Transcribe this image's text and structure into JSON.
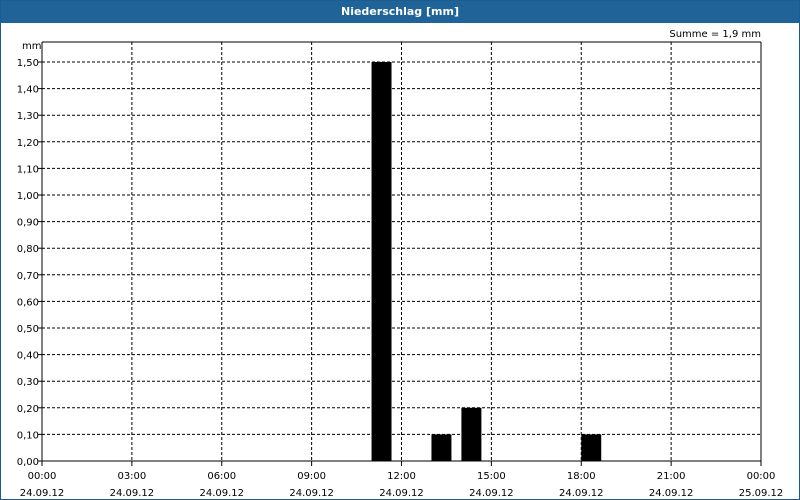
{
  "window": {
    "title": "Niederschlag [mm]"
  },
  "colors": {
    "titlebar": "#1f6399",
    "bars": "#000000"
  },
  "chart_data": {
    "type": "bar",
    "title": "Niederschlag [mm]",
    "ylabel": "mm",
    "summary": "Summe = 1,9 mm",
    "ylim": [
      0,
      1.5
    ],
    "yticks": [
      "0,00",
      "0,10",
      "0,20",
      "0,30",
      "0,40",
      "0,50",
      "0,60",
      "0,70",
      "0,80",
      "0,90",
      "1,00",
      "1,10",
      "1,20",
      "1,30",
      "1,40",
      "1,50"
    ],
    "xlim_hours": [
      0,
      24
    ],
    "xticks": [
      {
        "time": "00:00",
        "date": "24.09.12"
      },
      {
        "time": "03:00",
        "date": "24.09.12"
      },
      {
        "time": "06:00",
        "date": "24.09.12"
      },
      {
        "time": "09:00",
        "date": "24.09.12"
      },
      {
        "time": "12:00",
        "date": "24.09.12"
      },
      {
        "time": "15:00",
        "date": "24.09.12"
      },
      {
        "time": "18:00",
        "date": "24.09.12"
      },
      {
        "time": "21:00",
        "date": "24.09.12"
      },
      {
        "time": "00:00",
        "date": "25.09.12"
      }
    ],
    "bars": [
      {
        "start": "11:00",
        "end": "11:40",
        "value": 1.5
      },
      {
        "start": "13:00",
        "end": "13:40",
        "value": 0.1
      },
      {
        "start": "14:00",
        "end": "14:40",
        "value": 0.2
      },
      {
        "start": "18:00",
        "end": "18:40",
        "value": 0.1
      }
    ],
    "grid": true
  }
}
